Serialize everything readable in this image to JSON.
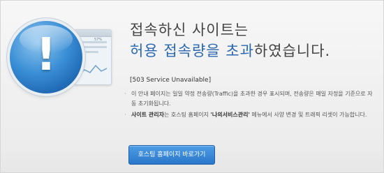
{
  "headline": {
    "line1": "접속하신 사이트는",
    "line2_part1": "허용 접속량을 초과",
    "line2_part2": "하였습니다."
  },
  "error_code": "[503 Service Unavailable]",
  "messages": [
    {
      "bold": "",
      "text": "이 안내 페이지는 일일 약정 전송량(Traffic)을 초과한 경우 표시되며, 전송량은 매일 자정을 기준으로 자동 초기화됩니다."
    },
    {
      "bold": "사이트 관리자",
      "mid": "는 호스팅 홈페이지 ",
      "bold2": "'나의서비스관리'",
      "text": " 메뉴에서 사양 변경 및 트래픽 리셋이 가능합니다."
    }
  ],
  "button": {
    "label": "호스팅 홈페이지 바로가기"
  },
  "illustration": {
    "icons": [
      "alert-icon",
      "browser-window-icon"
    ],
    "badge_text": "57%"
  },
  "colors": {
    "accent": "#2a67b1",
    "button": "#3a88d9"
  }
}
